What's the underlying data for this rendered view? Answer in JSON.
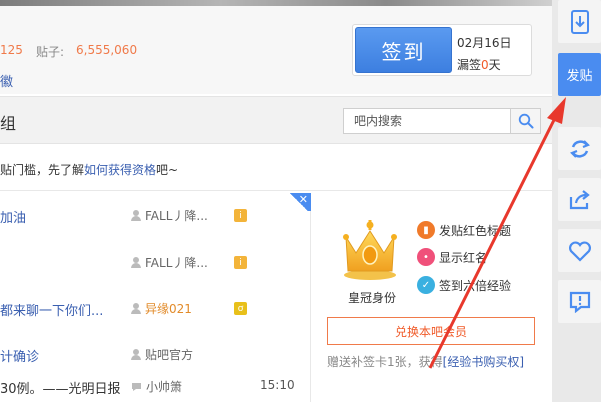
{
  "stats": {
    "members_count": "125",
    "posts_label": "贴子:",
    "posts_count": "6,555,060",
    "badge_text": "徽"
  },
  "signin": {
    "button_label": "签到",
    "date": "02月16日",
    "missed_prefix": "漏签",
    "missed_count": "0",
    "missed_suffix": "天"
  },
  "group_header": {
    "title": "组",
    "search_placeholder": "吧内搜索"
  },
  "notice": {
    "text_before": "贴门槛，先了解",
    "link_text": "如何获得资格",
    "text_after": "吧~"
  },
  "threads": [
    {
      "title": "加油",
      "author": "FALL丿降...",
      "badge": "i",
      "title_color": "blue",
      "author_color": "gray",
      "time": ""
    },
    {
      "title": "",
      "author": "FALL丿降...",
      "badge": "i",
      "title_color": "blue",
      "author_color": "gray",
      "time": ""
    },
    {
      "title": "都来聊一下你们...",
      "author": "异缘021",
      "badge": "ơ",
      "title_color": "blue",
      "author_color": "orange",
      "time": ""
    },
    {
      "title": "计确诊",
      "author": "贴吧官方",
      "badge": "",
      "title_color": "blue",
      "author_color": "gray",
      "time": ""
    },
    {
      "title": "30例。——光明日报",
      "author": "小帅箫",
      "badge": "",
      "title_color": "black",
      "author_color": "gray",
      "time": "15:10"
    }
  ],
  "member": {
    "identity_label": "皇冠身份",
    "perks": [
      {
        "label": "发贴红色标题",
        "color": "#f07a2a"
      },
      {
        "label": "显示红名",
        "color": "#f0507a"
      },
      {
        "label": "签到六倍经验",
        "color": "#3ab0e0"
      }
    ],
    "exchange_button": "兑换本吧会员",
    "gift_text": "赠送补签卡1张，获得",
    "gift_link": "[经验书购买权]"
  },
  "toolbar": {
    "post_label": "发贴",
    "buttons": [
      "download-icon",
      "post",
      "refresh-icon",
      "share-icon",
      "favorite-icon",
      "report-icon"
    ]
  },
  "colors": {
    "accent": "#4a8cf0",
    "orange": "#f07a4a",
    "link": "#3a5fb0",
    "arrow": "#e8382c"
  }
}
